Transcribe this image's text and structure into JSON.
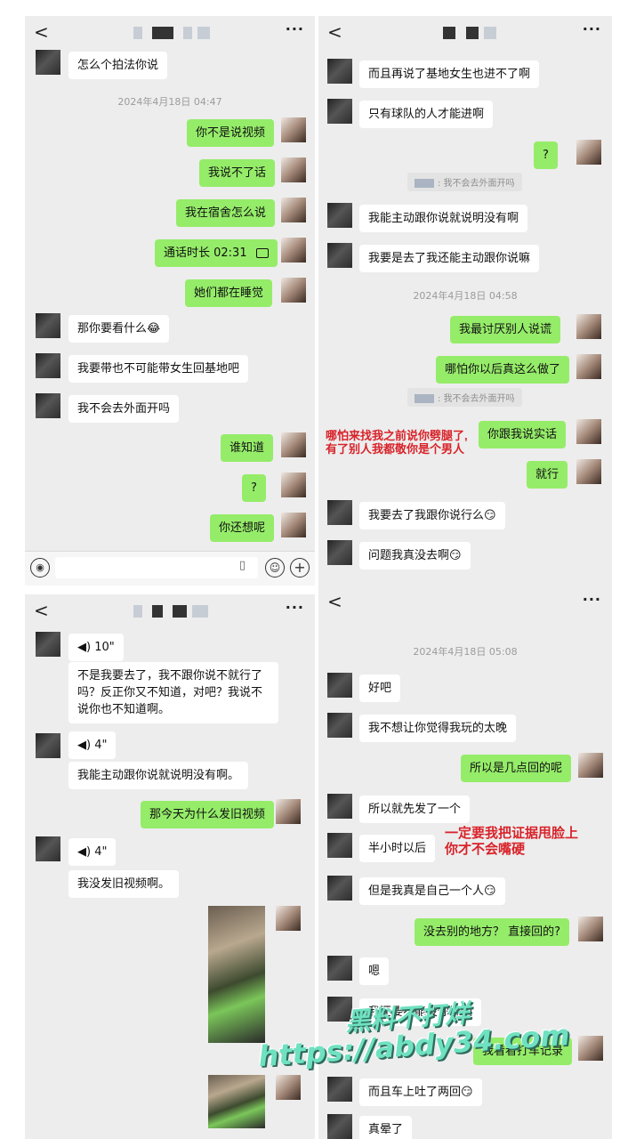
{
  "p1": {
    "header": {
      "back": "<",
      "more": "···"
    },
    "timestamp": "2024年4月18日 04:47",
    "messages": [
      {
        "side": "in",
        "text": "怎么个拍法你说"
      },
      {
        "side": "out",
        "text": "你不是说视频"
      },
      {
        "side": "out",
        "text": "我说不了话"
      },
      {
        "side": "out",
        "text": "我在宿舍怎么说"
      },
      {
        "side": "out",
        "text": "通话时长 02:31"
      },
      {
        "side": "out",
        "text": "她们都在睡觉"
      },
      {
        "side": "in",
        "text": "那你要看什么😂"
      },
      {
        "side": "in",
        "text": "我要带也不可能带女生回基地吧"
      },
      {
        "side": "in",
        "text": "我不会去外面开吗"
      },
      {
        "side": "out",
        "text": "谁知道"
      },
      {
        "side": "out",
        "text": "?"
      },
      {
        "side": "out",
        "text": "你还想呢"
      }
    ],
    "input": {
      "voice_icon": "voice-icon",
      "emoji_icon": "emoji-icon",
      "plus_icon": "plus-icon"
    }
  },
  "p2": {
    "header": {
      "back": "<",
      "more": "···"
    },
    "timestamp": "2024年4月18日 04:58",
    "messages": [
      {
        "side": "in",
        "text": "而且再说了基地女生也进不了啊"
      },
      {
        "side": "in",
        "text": "只有球队的人才能进啊"
      },
      {
        "side": "out",
        "text": "?"
      },
      {
        "side": "in",
        "text": "我能主动跟你说就说明没有啊"
      },
      {
        "side": "in",
        "text": "我要是去了我还能主动跟你说嘛"
      },
      {
        "side": "out",
        "text": "我最讨厌别人说谎"
      },
      {
        "side": "out",
        "text": "哪怕你以后真这么做了"
      },
      {
        "side": "out",
        "text": "你跟我说实话"
      },
      {
        "side": "out",
        "text": "就行"
      },
      {
        "side": "in",
        "text": "我要去了我跟你说行么😏"
      },
      {
        "side": "in",
        "text": "问题我真没去啊😏"
      }
    ],
    "quote1": ": 我不会去外面开吗",
    "quote2": ": 我不会去外面开吗",
    "annotation": [
      "哪怕来找我之前说你劈腿了,",
      "有了别人我都敬你是个男人"
    ]
  },
  "p3": {
    "header": {
      "back": "<",
      "more": "···"
    },
    "messages": [
      {
        "side": "in",
        "text": "10\""
      },
      {
        "side": "in",
        "text": "不是我要去了，我不跟你说不就行了吗？反正你又不知道，对吧？我说不说你也不知道啊。"
      },
      {
        "side": "in",
        "text": "4\""
      },
      {
        "side": "in",
        "text": "我能主动跟你说就说明没有啊。"
      },
      {
        "side": "out",
        "text": "那今天为什么发旧视频"
      },
      {
        "side": "in",
        "text": "4\""
      },
      {
        "side": "in",
        "text": "我没发旧视频啊。"
      }
    ]
  },
  "p4": {
    "header": {
      "back": "<",
      "more": "···"
    },
    "timestamp": "2024年4月18日 05:08",
    "messages": [
      {
        "side": "in",
        "text": "好吧"
      },
      {
        "side": "in",
        "text": "我不想让你觉得我玩的太晚"
      },
      {
        "side": "out",
        "text": "所以是几点回的呢"
      },
      {
        "side": "in",
        "text": "所以就先发了一个"
      },
      {
        "side": "in",
        "text": "半小时以后"
      },
      {
        "side": "in",
        "text": "但是我真是自己一个人😏"
      },
      {
        "side": "out",
        "text": "没去别的地方？ 直接回的?"
      },
      {
        "side": "in",
        "text": "嗯"
      },
      {
        "side": "in",
        "text": "我还要不能投你视频"
      },
      {
        "side": "out",
        "text": "我看看打车记录"
      },
      {
        "side": "in",
        "text": "而且车上吐了两回😏"
      },
      {
        "side": "in",
        "text": "真晕了"
      }
    ],
    "annotation": [
      "一定要我把证据甩脸上",
      "你才不会嘴硬"
    ]
  },
  "watermark": {
    "line1": "黑料不打烊",
    "line2": "https://abdy34.com"
  },
  "colors": {
    "outgoing": "#95ec69",
    "incoming": "#ffffff",
    "background": "#ededed",
    "annotation": "#d8232a",
    "watermark": "#6ee1c0"
  }
}
